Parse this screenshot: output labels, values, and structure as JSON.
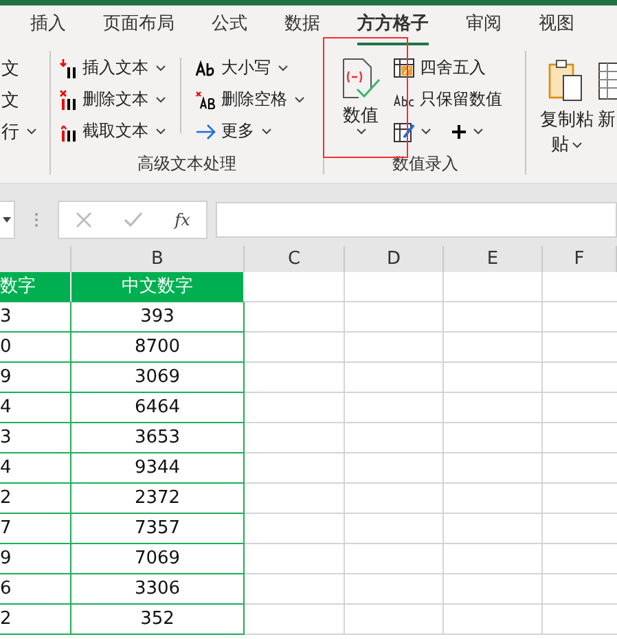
{
  "tabs": [
    {
      "label": "插入",
      "selected": false
    },
    {
      "label": "页面布局",
      "selected": false
    },
    {
      "label": "公式",
      "selected": false
    },
    {
      "label": "数据",
      "selected": false
    },
    {
      "label": "方方格子",
      "selected": true
    },
    {
      "label": "审阅",
      "selected": false
    },
    {
      "label": "视图",
      "selected": false
    }
  ],
  "ribbon": {
    "cut_group": [
      {
        "label": "文",
        "dropdown": false
      },
      {
        "label": "文",
        "dropdown": false
      },
      {
        "label": "行",
        "dropdown": true
      }
    ],
    "text_group": {
      "label": "高级文本处理",
      "items": [
        {
          "label": "插入文本",
          "dropdown": true
        },
        {
          "label": "删除文本",
          "dropdown": true
        },
        {
          "label": "截取文本",
          "dropdown": true
        },
        {
          "label": "大小写",
          "dropdown": true
        },
        {
          "label": "删除空格",
          "dropdown": true
        },
        {
          "label": "更多",
          "dropdown": true
        }
      ]
    },
    "number_group": {
      "label": "数值录入",
      "highlighted": true,
      "big_button": {
        "label": "数值",
        "dropdown": true
      },
      "items": [
        {
          "label": "四舍五入"
        },
        {
          "label": "只保留数值"
        }
      ],
      "small_buttons": [
        {
          "dropdown": true
        },
        {
          "dropdown": true
        }
      ]
    },
    "paste_button": {
      "label": "复制粘",
      "label_2": "贴",
      "dropdown": true
    },
    "cut_button": {
      "label": "新"
    }
  },
  "formula_bar": {
    "fx": "fx"
  },
  "sheet": {
    "columns": [
      "",
      "B",
      "C",
      "D",
      "E",
      "F"
    ],
    "header": [
      "数字",
      "中文数字"
    ],
    "rows": [
      [
        "3",
        "393"
      ],
      [
        "0",
        "8700"
      ],
      [
        "9",
        "3069"
      ],
      [
        "4",
        "6464"
      ],
      [
        "3",
        "3653"
      ],
      [
        "4",
        "9344"
      ],
      [
        "2",
        "2372"
      ],
      [
        "7",
        "7357"
      ],
      [
        "9",
        "7069"
      ],
      [
        "6",
        "3306"
      ],
      [
        "2",
        "352"
      ]
    ]
  }
}
